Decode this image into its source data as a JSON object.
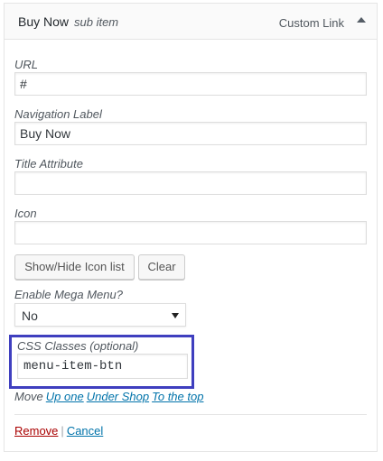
{
  "header": {
    "title": "Buy Now",
    "subtitle": "sub item",
    "type": "Custom Link"
  },
  "fields": {
    "url": {
      "label": "URL",
      "value": "#"
    },
    "nav_label": {
      "label": "Navigation Label",
      "value": "Buy Now"
    },
    "title_attr": {
      "label": "Title Attribute",
      "value": ""
    },
    "icon": {
      "label": "Icon",
      "value": ""
    }
  },
  "buttons": {
    "show_hide_icons": "Show/Hide Icon list",
    "clear": "Clear"
  },
  "mega_menu": {
    "label": "Enable Mega Menu?",
    "selected": "No"
  },
  "css_classes": {
    "label": "CSS Classes (optional)",
    "value": "menu-item-btn"
  },
  "move": {
    "label": "Move",
    "links": [
      "Up one",
      "Under Shop",
      "To the top"
    ]
  },
  "actions": {
    "remove": "Remove",
    "separator": "|",
    "cancel": "Cancel"
  },
  "colors": {
    "highlight_border": "#3f3fbf",
    "link": "#0073aa",
    "remove_link": "#aa0000"
  }
}
